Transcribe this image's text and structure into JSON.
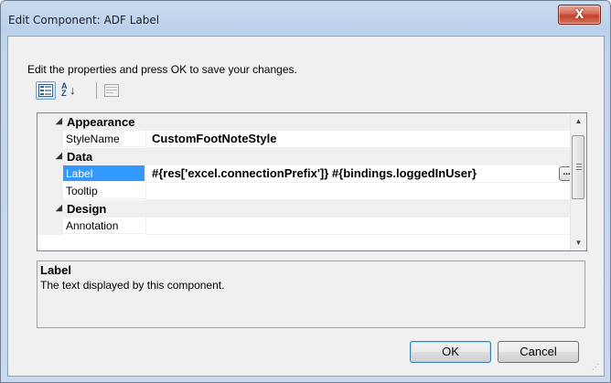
{
  "window": {
    "title": "Edit Component: ADF Label",
    "close_glyph": "X"
  },
  "instructions": "Edit the properties and press OK to save your changes.",
  "toolbar": {
    "categorized_icon": "categorized-view-icon",
    "alphabetical_icon": "alphabetical-sort-icon",
    "pages_icon": "property-pages-icon",
    "alpha_glyph": "A",
    "alpha_glyph2": "Z"
  },
  "grid": {
    "categories": [
      {
        "label": "Appearance",
        "expander": "◢"
      },
      {
        "label": "Data",
        "expander": "◢"
      },
      {
        "label": "Design",
        "expander": "◢"
      }
    ],
    "properties": [
      {
        "name": "StyleName",
        "value": "CustomFootNoteStyle"
      },
      {
        "name": "Label",
        "value": "#{res['excel.connectionPrefix']} #{bindings.loggedInUser}"
      },
      {
        "name": "Tooltip",
        "value": ""
      },
      {
        "name": "Annotation",
        "value": ""
      }
    ],
    "ellipsis": "...",
    "scroll_up": "▲",
    "scroll_down": "▼"
  },
  "description": {
    "title": "Label",
    "text": "The text displayed by this component."
  },
  "buttons": {
    "ok": "OK",
    "cancel": "Cancel"
  },
  "colors": {
    "selection": "#3399ff",
    "close": "#c3432c"
  }
}
